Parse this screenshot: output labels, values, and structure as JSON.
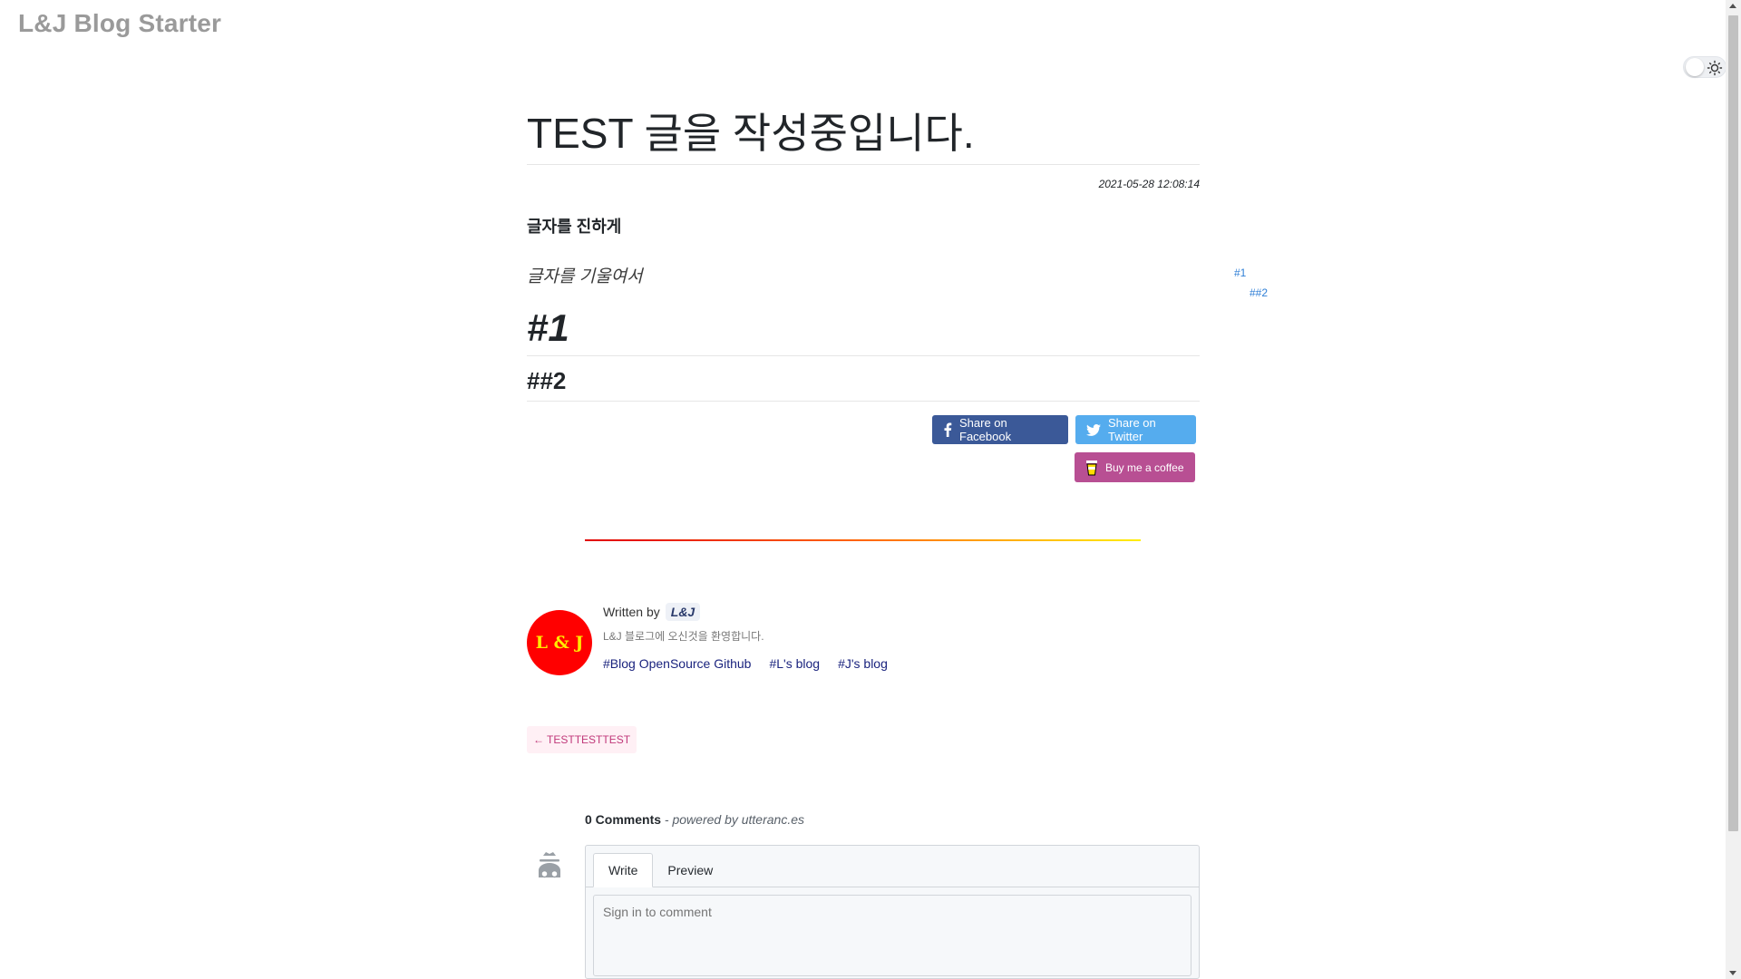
{
  "site": {
    "title": "L&J Blog Starter"
  },
  "post": {
    "title": "TEST 글을 작성중입니다.",
    "date": "2021-05-28 12:08:14",
    "bold_text": "글자를 진하게",
    "italic_text": "글자를 기울여서",
    "heading1": "#1",
    "heading2": "##2"
  },
  "toc": {
    "items": [
      {
        "label": "#1"
      },
      {
        "label": "##2"
      }
    ]
  },
  "share": {
    "facebook_label": "Share on Facebook",
    "twitter_label": "Share on Twitter",
    "coffee_label": "Buy me a coffee",
    "facebook_color": "#3b5998",
    "twitter_color": "#55acee",
    "coffee_color": "#b84f93"
  },
  "author": {
    "written_by": "Written by",
    "name_badge": "L&J",
    "avatar_text": "L & J",
    "description": "L&J 블로그에 오신것을 환영합니다.",
    "links": [
      "#Blog OpenSource Github",
      "#L's blog",
      "#J's blog"
    ]
  },
  "navigation": {
    "prev_post_label": "← TESTTESTTEST"
  },
  "comments": {
    "count_label": "0 Comments",
    "powered_by": "- powered by utteranc.es",
    "tabs": [
      "Write",
      "Preview"
    ],
    "placeholder": "Sign in to comment"
  }
}
